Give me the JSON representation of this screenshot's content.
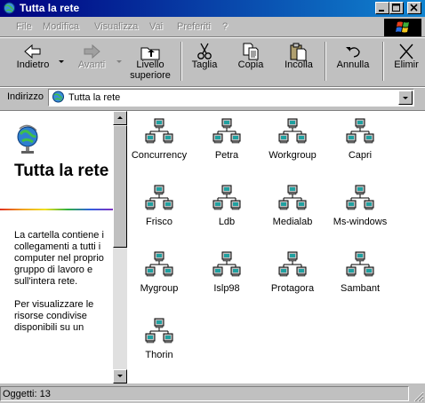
{
  "window": {
    "title": "Tutta la rete"
  },
  "menu": [
    "File",
    "Modifica",
    "Visualizza",
    "Vai",
    "Preferiti",
    "?"
  ],
  "toolbar": {
    "back": "Indietro",
    "forward": "Avanti",
    "up": "Livello superiore",
    "cut": "Taglia",
    "copy": "Copia",
    "paste": "Incolla",
    "undo": "Annulla",
    "delete": "Elimir"
  },
  "address": {
    "label": "Indirizzo",
    "value": "Tutta la rete"
  },
  "sidebar": {
    "title": "Tutta la rete",
    "description_1": "La cartella contiene i collegamenti a tutti i computer nel proprio gruppo di lavoro e sull'intera rete.",
    "description_2": "Per visualizzare le risorse condivise disponibili su un"
  },
  "items": [
    "Concurrency",
    "Petra",
    "Workgroup",
    "Capri",
    "Frisco",
    "Ldb",
    "Medialab",
    "Ms-windows",
    "Mygroup",
    "Islp98",
    "Protagora",
    "Sambant",
    "Thorin"
  ],
  "status": {
    "text": "Oggetti: 13"
  }
}
